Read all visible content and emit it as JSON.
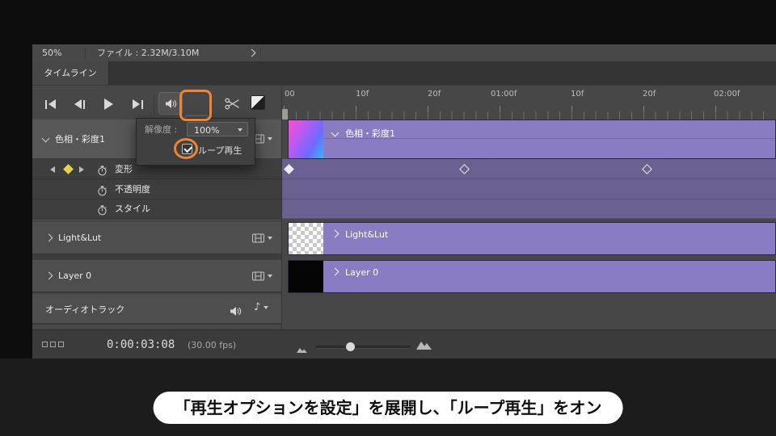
{
  "header": {
    "zoom_level": "50%",
    "file_info": "ファイル : 2.32M/3.10M",
    "tab_label": "タイムライン"
  },
  "settings_popover": {
    "resolution_label": "解像度 :",
    "resolution_value": "100%",
    "loop_playback_label": "ループ再生"
  },
  "ruler_labels": [
    "00",
    "10f",
    "20f",
    "01:00f",
    "10f",
    "20f",
    "02:00f"
  ],
  "layers": {
    "hue_saturation": {
      "label": "色相・彩度1"
    },
    "light_lut": {
      "label": "Light&Lut"
    },
    "layer0": {
      "label": "Layer 0"
    },
    "audio": {
      "label": "オーディオトラック"
    }
  },
  "properties": [
    {
      "label": "変形"
    },
    {
      "label": "不透明度"
    },
    {
      "label": "スタイル"
    }
  ],
  "status_bar": {
    "timecode": "0:00:03:08",
    "fps": "(30.00 fps)"
  },
  "icons": {
    "music_note": "♪"
  },
  "caption": "「再生オプションを設定」を展開し、「ループ再生」をオン",
  "colors": {
    "accent_orange": "#ee8434",
    "track_purple": "#8a7cc2",
    "property_purple": "#6b6190",
    "keyframe_yellow": "#e6d24b"
  }
}
